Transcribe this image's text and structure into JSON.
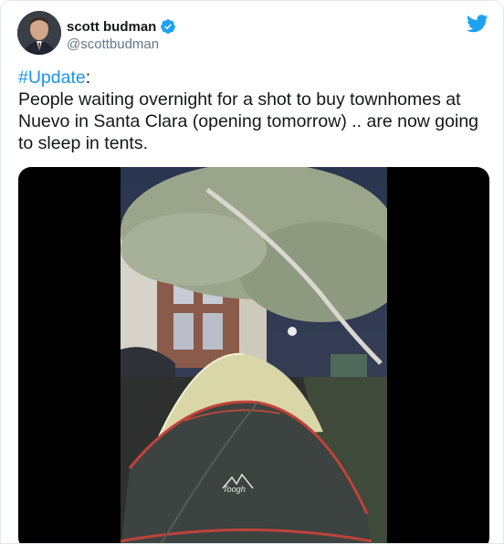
{
  "tweet": {
    "author_name": "scott budman",
    "author_handle": "@scottbudman",
    "hashtag": "#Update",
    "after_hashtag": ":",
    "body": "People waiting overnight for a shot to buy townhomes at Nuevo in Santa Clara (opening tomorrow) .. are now going to sleep in tents."
  },
  "icons": {
    "verified": "verified-badge-icon",
    "brand": "twitter-bird-icon"
  },
  "media": {
    "tent_logo_text": "Toogh"
  },
  "colors": {
    "link": "#1b95e0",
    "verified": "#1da1f2",
    "twitter_brand": "#1da1f2",
    "handle": "#657786"
  }
}
